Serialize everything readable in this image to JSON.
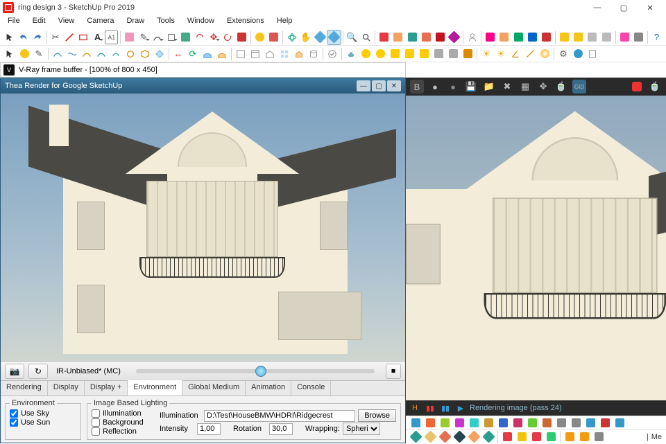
{
  "window": {
    "title": "ring design 3 - SketchUp Pro 2019",
    "controls": {
      "min": "—",
      "max": "▢",
      "close": "✕"
    }
  },
  "menu": [
    "File",
    "Edit",
    "View",
    "Camera",
    "Draw",
    "Tools",
    "Window",
    "Extensions",
    "Help"
  ],
  "framebuffer": {
    "title": "V-Ray frame buffer - [100% of 800 x 450]"
  },
  "thea": {
    "title": "Thea Render for Google SketchUp",
    "mode": "IR-Unbiased* (MC)",
    "tabs": [
      "Rendering",
      "Display",
      "Display +",
      "Environment",
      "Global Medium",
      "Animation",
      "Console"
    ],
    "active_tab": "Environment",
    "env": {
      "legend": "Environment",
      "use_sky": "Use Sky",
      "use_sun": "Use Sun"
    },
    "ibl": {
      "legend": "Image Based Lighting",
      "illumination_chk": "Illumination",
      "background_chk": "Background",
      "reflection_chk": "Reflection",
      "illum_label": "Illumination",
      "illum_path": "D:\\Test\\HouseBMW\\HDRI\\Ridgecrest",
      "browse": "Browse",
      "intensity_label": "Intensity",
      "intensity_val": "1,00",
      "rotation_label": "Rotation",
      "rotation_val": "30,0",
      "wrapping_label": "Wrapping:",
      "wrapping_val": "Spheri"
    }
  },
  "rpanel": {
    "letter": "B",
    "status": "Rendering image (pass 24)"
  },
  "status_corner": "Me"
}
